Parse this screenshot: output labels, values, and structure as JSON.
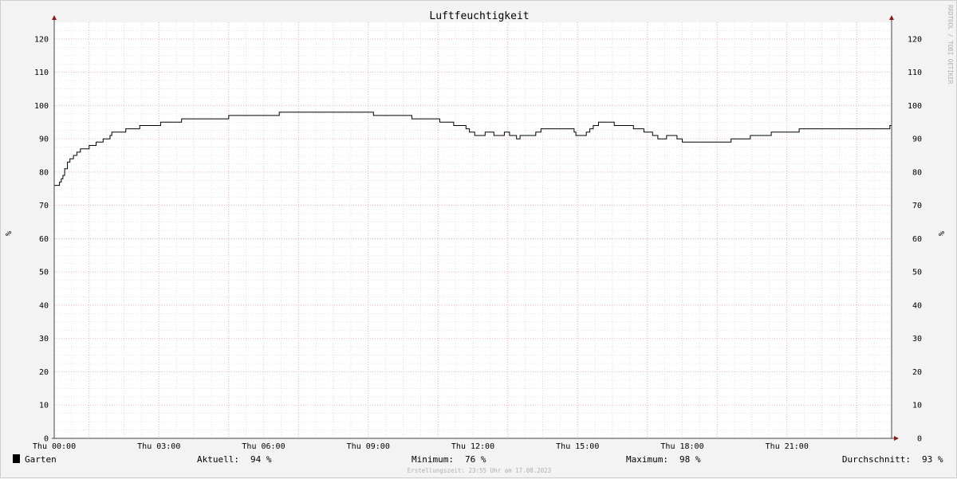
{
  "chart_data": {
    "type": "line",
    "title": "Luftfeuchtigkeit",
    "ylabel": "%",
    "ylabel_right": "%",
    "ylim": [
      0,
      125
    ],
    "yticks": [
      0,
      10,
      20,
      30,
      40,
      50,
      60,
      70,
      80,
      90,
      100,
      110,
      120
    ],
    "xlim_hours": [
      0,
      24
    ],
    "xticks": [
      {
        "hour": 0,
        "label": "Thu 00:00"
      },
      {
        "hour": 3,
        "label": "Thu 03:00"
      },
      {
        "hour": 6,
        "label": "Thu 06:00"
      },
      {
        "hour": 9,
        "label": "Thu 09:00"
      },
      {
        "hour": 12,
        "label": "Thu 12:00"
      },
      {
        "hour": 15,
        "label": "Thu 15:00"
      },
      {
        "hour": 18,
        "label": "Thu 18:00"
      },
      {
        "hour": 21,
        "label": "Thu 21:00"
      }
    ],
    "grid": true,
    "legend_position": "bottom",
    "series": [
      {
        "name": "Garten",
        "color": "#000000",
        "step": true,
        "points": [
          [
            0.0,
            76
          ],
          [
            0.15,
            77
          ],
          [
            0.2,
            78
          ],
          [
            0.25,
            79
          ],
          [
            0.3,
            81
          ],
          [
            0.38,
            83
          ],
          [
            0.45,
            84
          ],
          [
            0.55,
            85
          ],
          [
            0.65,
            86
          ],
          [
            0.75,
            87
          ],
          [
            1.0,
            88
          ],
          [
            1.2,
            89
          ],
          [
            1.4,
            90
          ],
          [
            1.6,
            91
          ],
          [
            1.65,
            92
          ],
          [
            2.05,
            93
          ],
          [
            2.45,
            94
          ],
          [
            3.05,
            95
          ],
          [
            3.65,
            96
          ],
          [
            5.0,
            97
          ],
          [
            6.45,
            98
          ],
          [
            9.15,
            97
          ],
          [
            10.25,
            96
          ],
          [
            11.05,
            95
          ],
          [
            11.45,
            94
          ],
          [
            11.8,
            93
          ],
          [
            11.9,
            92
          ],
          [
            12.05,
            91
          ],
          [
            12.35,
            92
          ],
          [
            12.6,
            91
          ],
          [
            12.9,
            92
          ],
          [
            13.05,
            91
          ],
          [
            13.25,
            90
          ],
          [
            13.35,
            91
          ],
          [
            13.8,
            92
          ],
          [
            13.95,
            93
          ],
          [
            14.9,
            92
          ],
          [
            14.95,
            91
          ],
          [
            15.25,
            92
          ],
          [
            15.35,
            93
          ],
          [
            15.45,
            94
          ],
          [
            15.6,
            95
          ],
          [
            16.05,
            94
          ],
          [
            16.6,
            93
          ],
          [
            16.9,
            92
          ],
          [
            17.15,
            91
          ],
          [
            17.3,
            90
          ],
          [
            17.55,
            91
          ],
          [
            17.85,
            90
          ],
          [
            18.0,
            89
          ],
          [
            19.4,
            90
          ],
          [
            19.95,
            91
          ],
          [
            20.55,
            92
          ],
          [
            21.35,
            93
          ],
          [
            23.95,
            94
          ]
        ]
      }
    ],
    "legend": {
      "series_name": "Garten",
      "stats": [
        {
          "label": "Aktuell:",
          "value": "94 %"
        },
        {
          "label": "Minimum:",
          "value": "76 %"
        },
        {
          "label": "Maximum:",
          "value": "98 %"
        },
        {
          "label": "Durchschnitt:",
          "value": "93 %"
        }
      ]
    },
    "footer": "Erstellungszeit: 23:55 Uhr am 17.08.2023",
    "watermark": "RRDTOOL / TOBI OETIKER",
    "colors": {
      "background": "#f3f3f3",
      "canvas": "#ffffff",
      "major_grid": "#f2a5b4",
      "minor_grid": "#d6d6d6",
      "axis": "#444444",
      "arrow": "#8b1a1a",
      "line": "#000000"
    }
  }
}
